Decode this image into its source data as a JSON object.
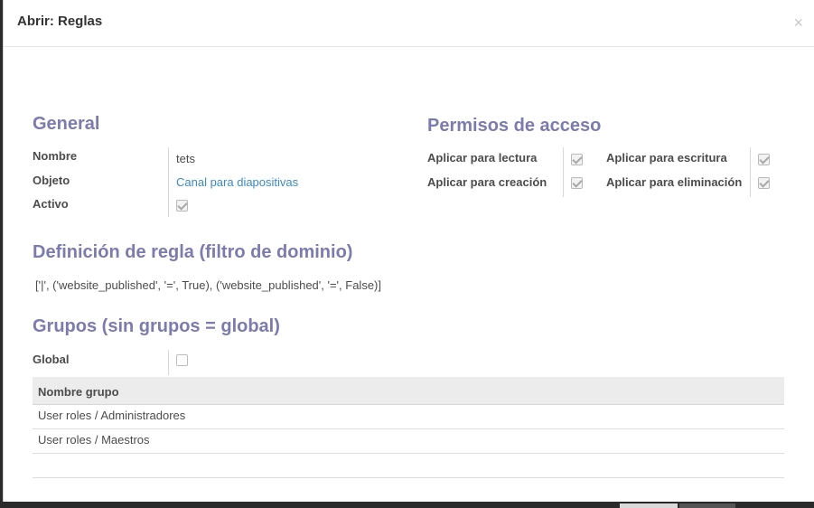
{
  "dialog": {
    "title": "Abrir: Reglas",
    "close_glyph": "×"
  },
  "general": {
    "heading": "General",
    "name_label": "Nombre",
    "name_value": "tets",
    "object_label": "Objeto",
    "object_value": "Canal para diapositivas",
    "active_label": "Activo",
    "active_checked": true
  },
  "access": {
    "heading": "Permisos de acceso",
    "read_label": "Aplicar para lectura",
    "read_checked": true,
    "write_label": "Aplicar para escritura",
    "write_checked": true,
    "create_label": "Aplicar para creación",
    "create_checked": true,
    "delete_label": "Aplicar para eliminación",
    "delete_checked": true
  },
  "rule_def": {
    "heading": "Definición de regla (filtro de dominio)",
    "domain": "['|', ('website_published', '=', True),  ('website_published', '=', False)]"
  },
  "groups": {
    "heading": "Grupos (sin grupos = global)",
    "global_label": "Global",
    "global_checked": false,
    "column_header": "Nombre grupo",
    "rows": [
      "User roles / Administradores",
      "User roles / Maestros"
    ]
  },
  "colors": {
    "section_heading": "#7c7bad",
    "link": "#3b8ac6"
  }
}
